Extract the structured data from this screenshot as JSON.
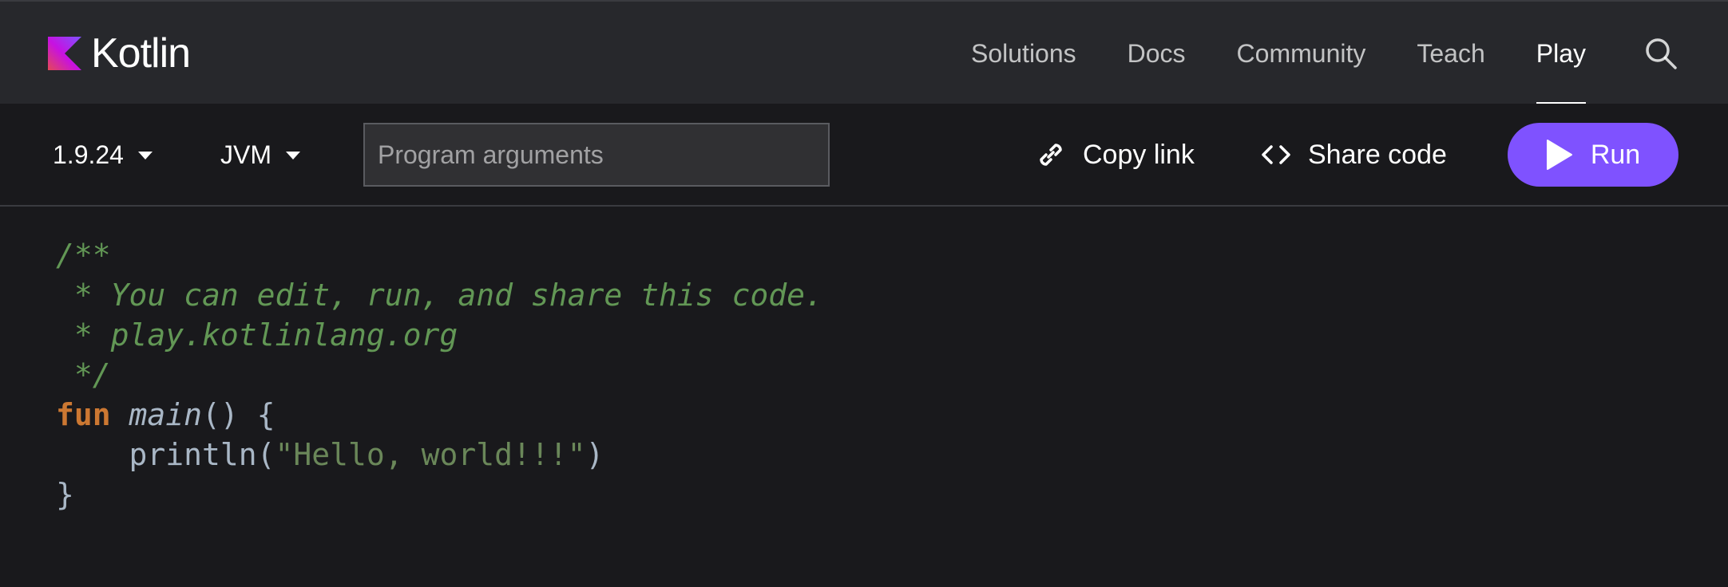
{
  "header": {
    "logo_text": "Kotlin",
    "nav": [
      {
        "label": "Solutions",
        "active": false
      },
      {
        "label": "Docs",
        "active": false
      },
      {
        "label": "Community",
        "active": false
      },
      {
        "label": "Teach",
        "active": false
      },
      {
        "label": "Play",
        "active": true
      }
    ],
    "search_icon": "search-icon"
  },
  "toolbar": {
    "version": "1.9.24",
    "platform": "JVM",
    "args_placeholder": "Program arguments",
    "args_value": "",
    "copy_link_label": "Copy link",
    "share_code_label": "Share code",
    "run_label": "Run"
  },
  "editor": {
    "lines": [
      [
        {
          "t": "/**",
          "s": "comment"
        }
      ],
      [
        {
          "t": " * You can edit, run, and share this code.",
          "s": "comment"
        }
      ],
      [
        {
          "t": " * play.kotlinlang.org",
          "s": "comment"
        }
      ],
      [
        {
          "t": " */",
          "s": "comment"
        }
      ],
      [
        {
          "t": "fun",
          "s": "kw"
        },
        {
          "t": " ",
          "s": "plain"
        },
        {
          "t": "main",
          "s": "fn"
        },
        {
          "t": "() {",
          "s": "plain"
        }
      ],
      [
        {
          "t": "    println(",
          "s": "plain"
        },
        {
          "t": "\"Hello, world!!!\"",
          "s": "str"
        },
        {
          "t": ")",
          "s": "plain"
        }
      ],
      [
        {
          "t": "}",
          "s": "plain"
        }
      ]
    ]
  },
  "colors": {
    "accent": "#7f52ff",
    "header_bg": "#27282c",
    "page_bg": "#19191c",
    "comment": "#629755",
    "keyword": "#cc7832",
    "string": "#6a8759"
  }
}
